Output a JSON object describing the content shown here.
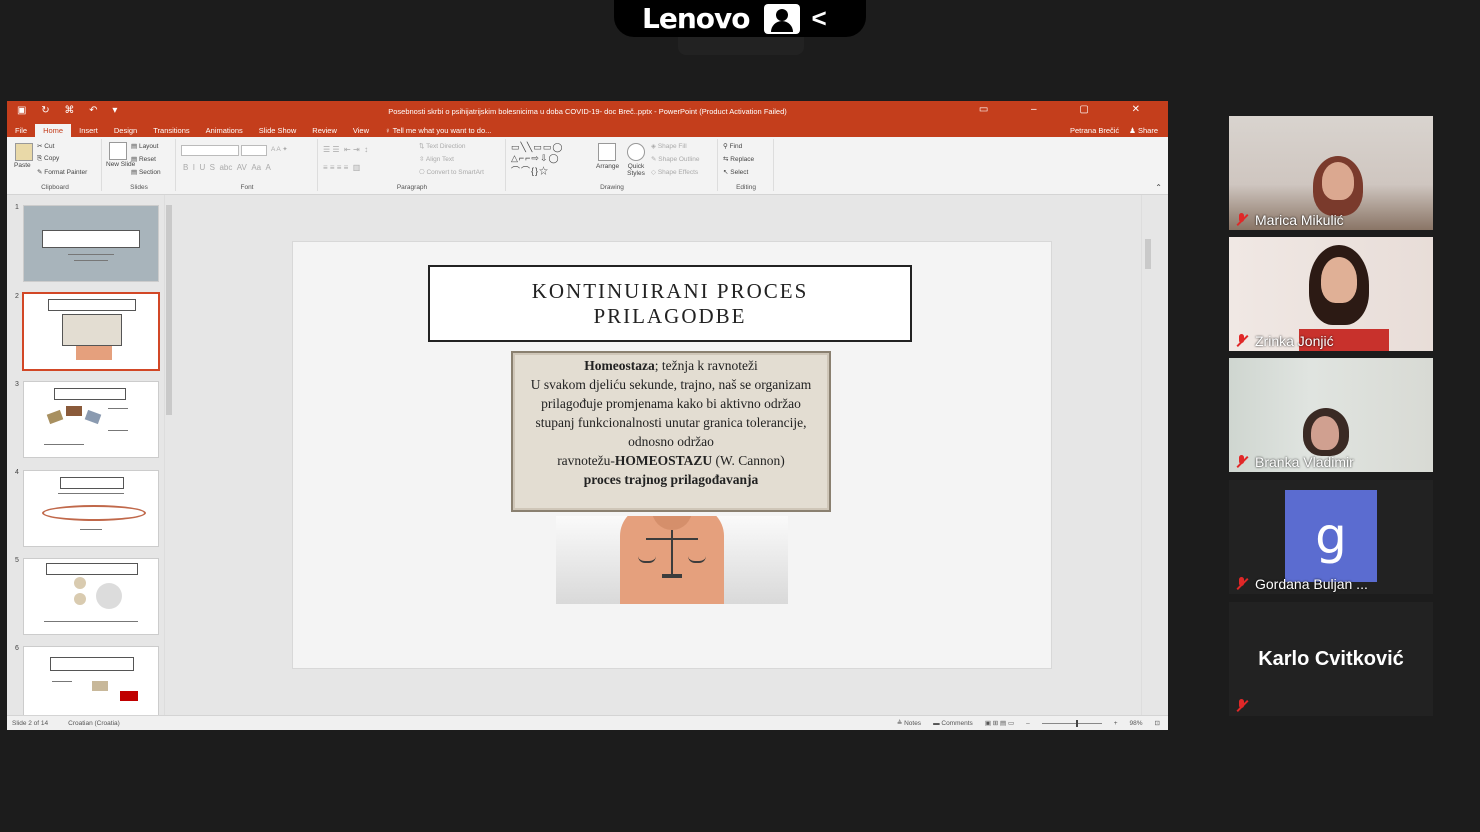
{
  "topbar": {
    "brand": "Lenovo",
    "collapse": "<"
  },
  "ppt": {
    "title": "Posebnosti skrbi o psihijatrijskim bolesnicima u doba COVID-19- doc Breč..pptx - PowerPoint (Product Activation Failed)",
    "tabs": [
      "File",
      "Home",
      "Insert",
      "Design",
      "Transitions",
      "Animations",
      "Slide Show",
      "Review",
      "View"
    ],
    "tell_me": "Tell me what you want to do...",
    "account": "Petrana Brečić",
    "share": "Share",
    "ribbon": {
      "paste": "Paste",
      "cut": "Cut",
      "copy": "Copy",
      "format_painter": "Format Painter",
      "clipboard": "Clipboard",
      "new_slide": "New Slide",
      "layout": "Layout",
      "reset": "Reset",
      "section": "Section",
      "slides": "Slides",
      "font": "Font",
      "text_direction": "Text Direction",
      "align_text": "Align Text",
      "convert_smartart": "Convert to SmartArt",
      "paragraph": "Paragraph",
      "arrange": "Arrange",
      "quick_styles": "Quick Styles",
      "shape_fill": "Shape Fill",
      "shape_outline": "Shape Outline",
      "shape_effects": "Shape Effects",
      "drawing": "Drawing",
      "find": "Find",
      "replace": "Replace",
      "select": "Select",
      "editing": "Editing"
    },
    "thumb_numbers": [
      "1",
      "2",
      "3",
      "4",
      "5",
      "6"
    ],
    "slide": {
      "title": "KONTINUIRANI PROCES PRILAGODBE",
      "box_line1_bold": "Homeostaza",
      "box_line1_rest": "; težnja k ravnoteži",
      "box_line2": "U svakom djeliću sekunde, trajno, naš se organizam prilagođuje promjenama kako bi aktivno održao stupanj funkcionalnosti unutar granica tolerancije,",
      "box_line3": "odnosno održao",
      "box_line4_pre": "ravnotežu-",
      "box_line4_bold": "HOMEOSTAZU",
      "box_line4_post": " (W. Cannon)",
      "box_line5": "proces trajnog prilagođavanja"
    },
    "status": {
      "slide_of": "Slide 2 of 14",
      "language": "Croatian (Croatia)",
      "notes": "Notes",
      "comments": "Comments",
      "zoom": "98%"
    }
  },
  "participants": [
    {
      "name": "Marica Mikulić"
    },
    {
      "name": "Zrinka Jonjić"
    },
    {
      "name": "Branka Vladimir"
    },
    {
      "name": "Gordana Buljan ...",
      "avatar_letter": "g",
      "avatar_color": "#5b6cd0"
    },
    {
      "name": "Karlo Cvitković"
    }
  ],
  "colors": {
    "ppt_accent": "#c43e1c",
    "muted_mic": "#e02828"
  }
}
